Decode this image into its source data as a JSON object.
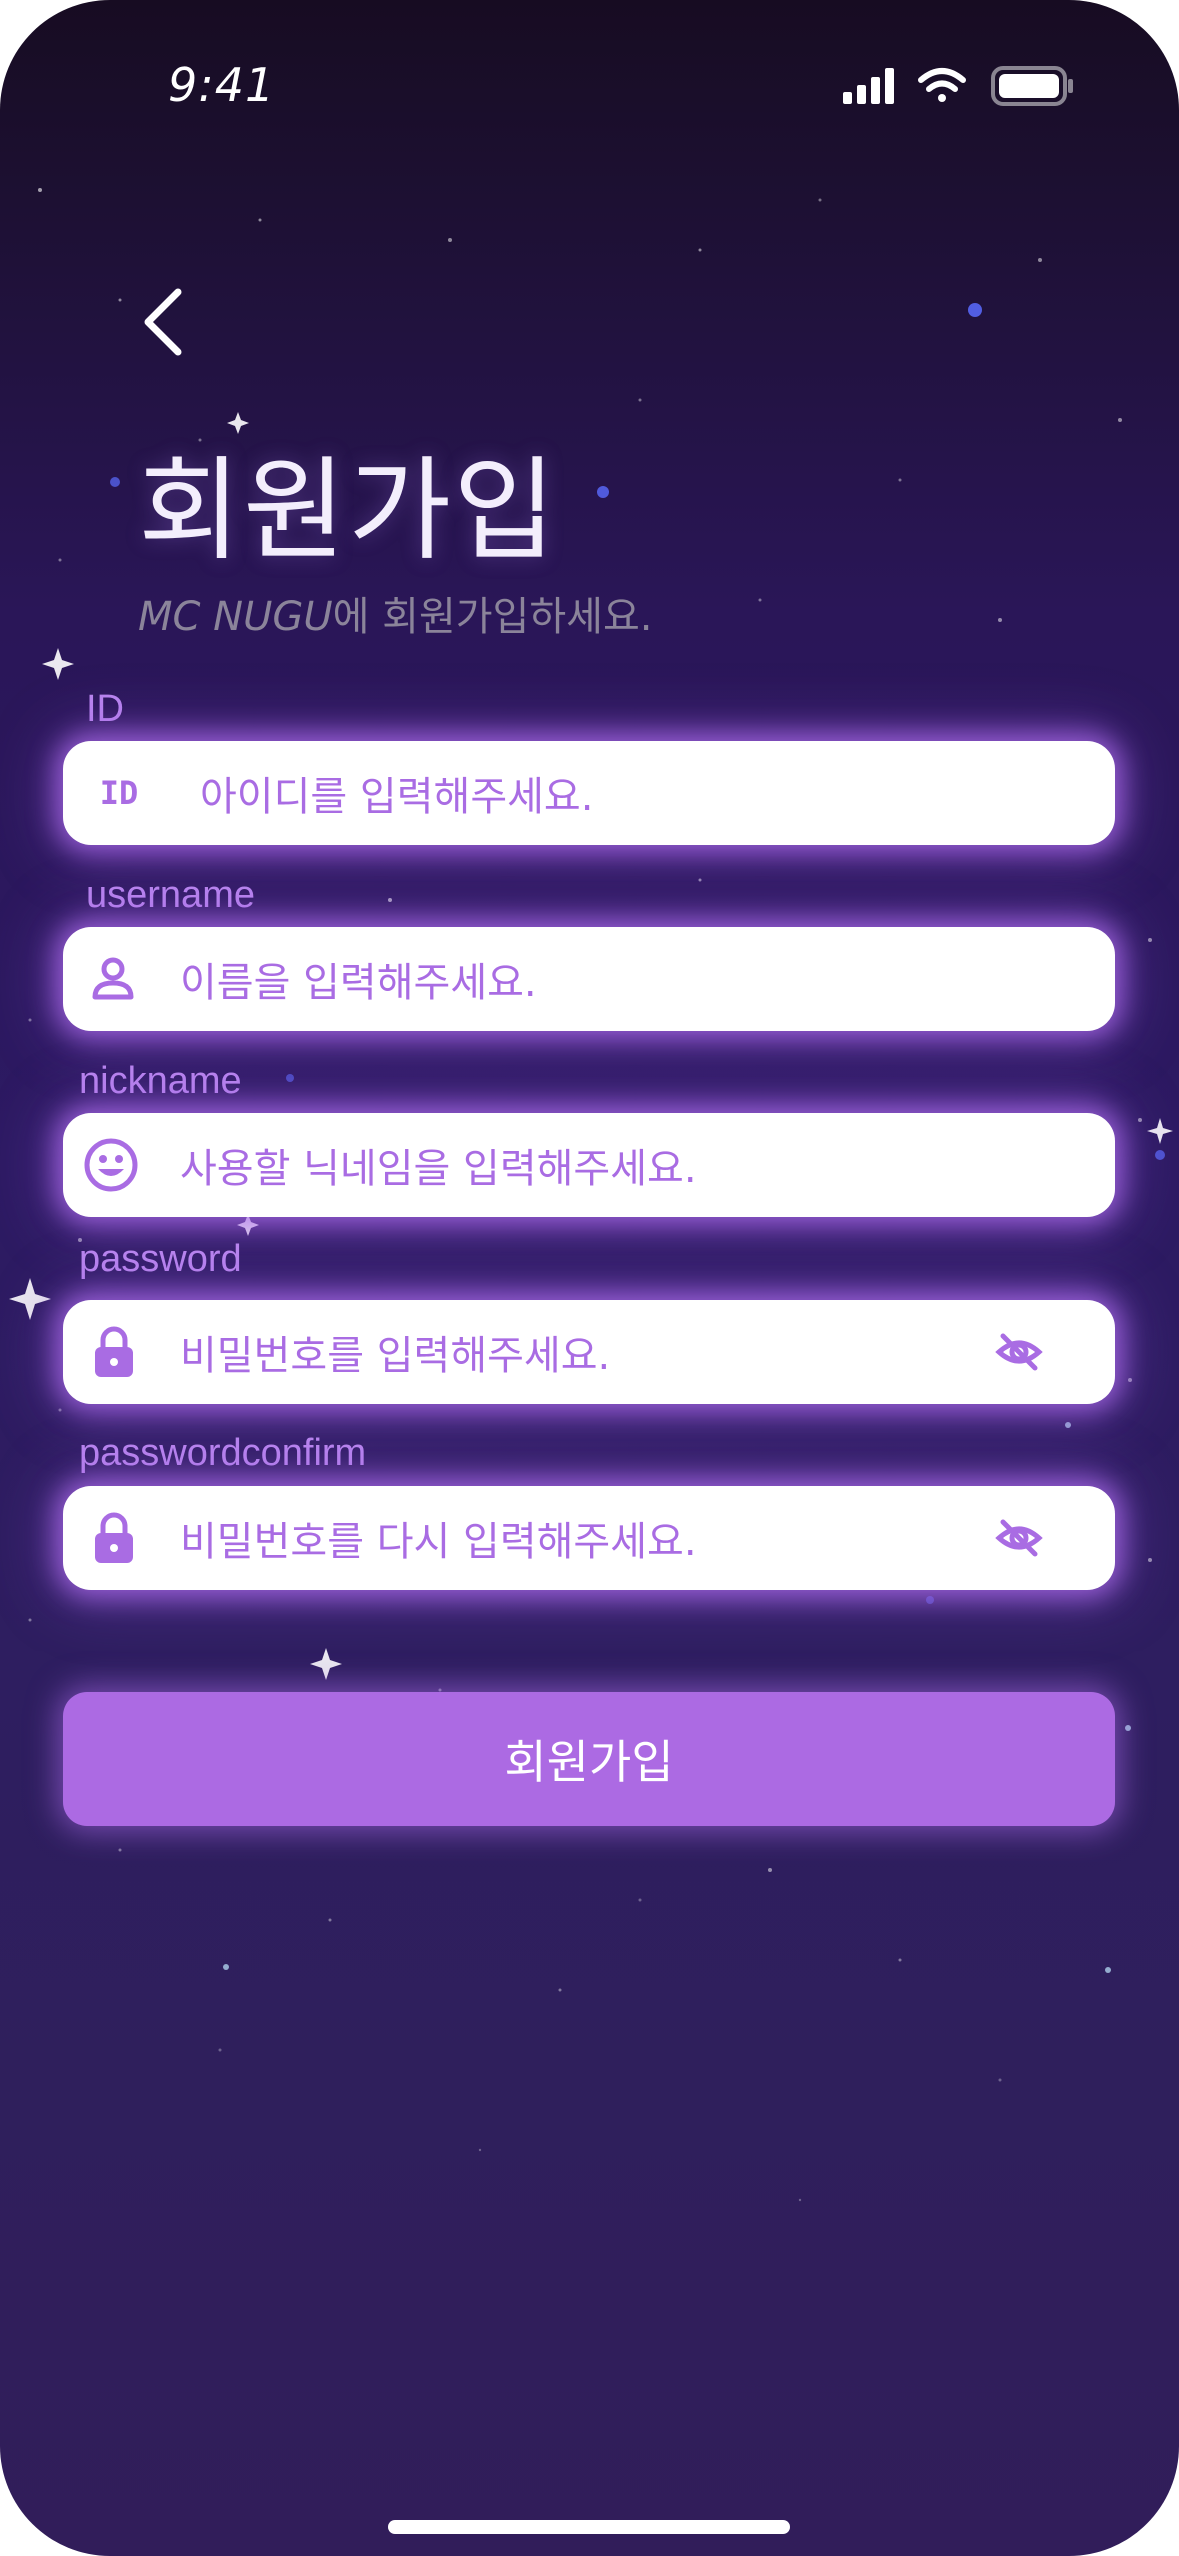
{
  "status_bar": {
    "time": "9:41",
    "icons": [
      "signal-icon",
      "wifi-icon",
      "battery-icon"
    ]
  },
  "header": {
    "back_icon": "chevron-left-icon",
    "title": "회원가입",
    "subtitle_brand": "MC NUGU",
    "subtitle_text": "에 회원가입하세요."
  },
  "form": {
    "fields": [
      {
        "label": "ID",
        "icon": "id-icon",
        "icon_text": "ID",
        "placeholder": "아이디를 입력해주세요."
      },
      {
        "label": "username",
        "icon": "person-icon",
        "placeholder": "이름을 입력해주세요."
      },
      {
        "label": "nickname",
        "icon": "smiley-icon",
        "placeholder": "사용할 닉네임을 입력해주세요."
      },
      {
        "label": "password",
        "icon": "lock-icon",
        "placeholder": "비밀번호를 입력해주세요.",
        "toggle_icon": "eye-off-icon"
      },
      {
        "label": "passwordconfirm",
        "icon": "lock-icon",
        "placeholder": "비밀번호를 다시 입력해주세요.",
        "toggle_icon": "eye-off-icon"
      }
    ],
    "submit_label": "회원가입"
  },
  "colors": {
    "accent": "#ac6ae3",
    "label": "#b985ef",
    "placeholder": "#a96ce3",
    "background_top": "#170c22",
    "background_bottom": "#311d5a"
  }
}
